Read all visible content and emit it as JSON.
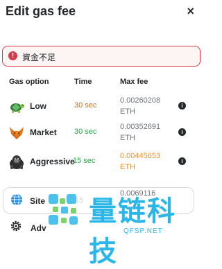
{
  "header": {
    "title": "Edit gas fee",
    "close_icon": "×"
  },
  "alert": {
    "icon": "!",
    "text": "資金不足",
    "color": "#d73a49"
  },
  "columns": {
    "option": "Gas option",
    "time": "Time",
    "fee": "Max fee"
  },
  "options": [
    {
      "label": "Low",
      "time": "30 sec",
      "fee": "0.00260208",
      "unit": "ETH",
      "icon": "turtle-icon",
      "time_color": "#b5722c",
      "fee_color": "#6a737d"
    },
    {
      "label": "Market",
      "time": "30 sec",
      "fee": "0.00352691",
      "unit": "ETH",
      "icon": "fox-icon",
      "time_color": "#28a745",
      "fee_color": "#6a737d"
    },
    {
      "label": "Aggressive",
      "time": "15 sec",
      "fee": "0.00445653",
      "unit": "ETH",
      "icon": "gorilla-icon",
      "time_color": "#28a745",
      "fee_color": "#e8902a"
    }
  ],
  "site_row": {
    "label": "Site",
    "time": "15",
    "fee": "0.0069116"
  },
  "advanced": {
    "label": "Adv"
  },
  "info_icon": "i",
  "watermark": {
    "text": "量链科技",
    "sub": "QFSP.NET",
    "color": "#2bb6e8"
  }
}
